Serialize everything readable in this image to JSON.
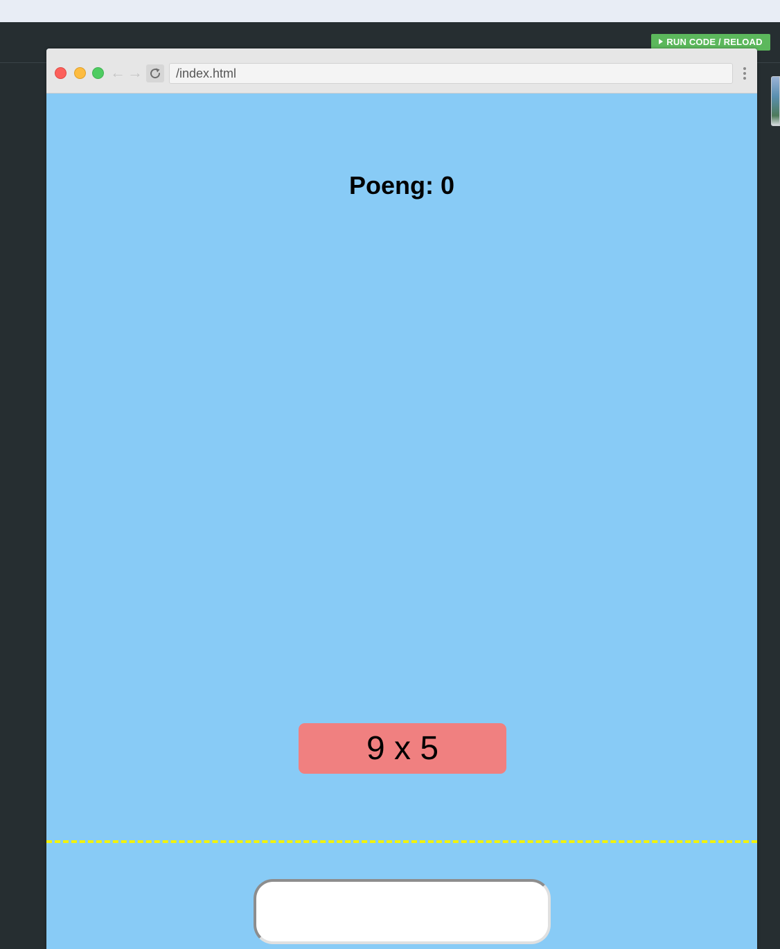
{
  "editor": {
    "run_button_label": "RUN CODE / RELOAD"
  },
  "browser": {
    "url": "/index.html"
  },
  "game": {
    "score_text": "Poeng: 0",
    "task_text": "9 x 5",
    "answer_value": "",
    "colors": {
      "background": "#88cbf6",
      "task_box": "#f08080",
      "deadline_line": "#f2f20a"
    }
  }
}
